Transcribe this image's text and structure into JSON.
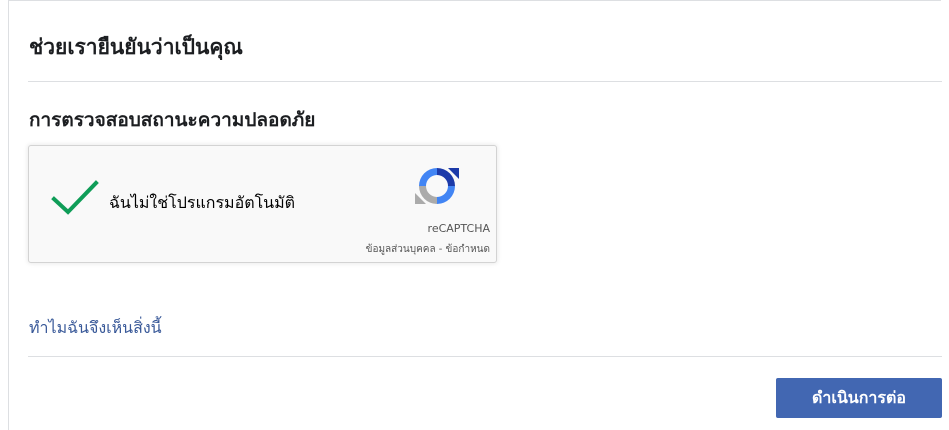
{
  "header": {
    "title": "ช่วยเรายืนยันว่าเป็นคุณ"
  },
  "security_check": {
    "title": "การตรวจสอบสถานะความปลอดภัย"
  },
  "recaptcha": {
    "checkbox_label": "ฉันไม่ใช่โปรแกรมอัตโนมัติ",
    "checked": true,
    "brand": "reCAPTCHA",
    "privacy_terms": "ข้อมูลส่วนบุคคล - ข้อกำหนด",
    "check_color": "#0f9d58",
    "icon": "recaptcha-logo-icon"
  },
  "footer": {
    "why_link": "ทำไมฉันจึงเห็นสิ่งนี้",
    "continue_label": "ดำเนินการต่อ",
    "button_color": "#4267b2",
    "link_color": "#385898"
  }
}
